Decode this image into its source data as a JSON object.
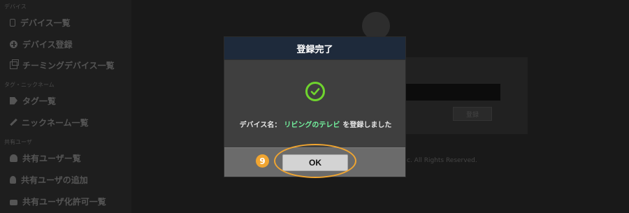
{
  "sidebar": {
    "sections": [
      {
        "label": "デバイス",
        "items": [
          {
            "label": "デバイス一覧",
            "icon": "phone-icon"
          },
          {
            "label": "デバイス登録",
            "icon": "plus-circle-icon"
          },
          {
            "label": "チーミングデバイス一覧",
            "icon": "copy-icon"
          }
        ]
      },
      {
        "label": "タグ・ニックネーム",
        "items": [
          {
            "label": "タグ一覧",
            "icon": "tag-icon"
          },
          {
            "label": "ニックネーム一覧",
            "icon": "pencil-icon"
          }
        ]
      },
      {
        "label": "共有ユーザ",
        "items": [
          {
            "label": "共有ユーザー覧",
            "icon": "user-icon"
          },
          {
            "label": "共有ユーザの追加",
            "icon": "user-plus-icon"
          },
          {
            "label": "共有ユーザ化許可一覧",
            "icon": "lock-icon"
          }
        ]
      }
    ]
  },
  "background": {
    "button_label": "登録",
    "copyright": "c. All Rights Reserved."
  },
  "modal": {
    "title": "登録完了",
    "message_prefix": "デバイス名：",
    "device_name": "リビングのテレビ",
    "message_suffix": "を登録しました",
    "ok_label": "OK"
  },
  "annotation": {
    "step_number": "9",
    "color": "#f0a531"
  },
  "colors": {
    "success": "#6fd42e",
    "device_name": "#73f19e",
    "modal_header": "#1e2a3b"
  }
}
